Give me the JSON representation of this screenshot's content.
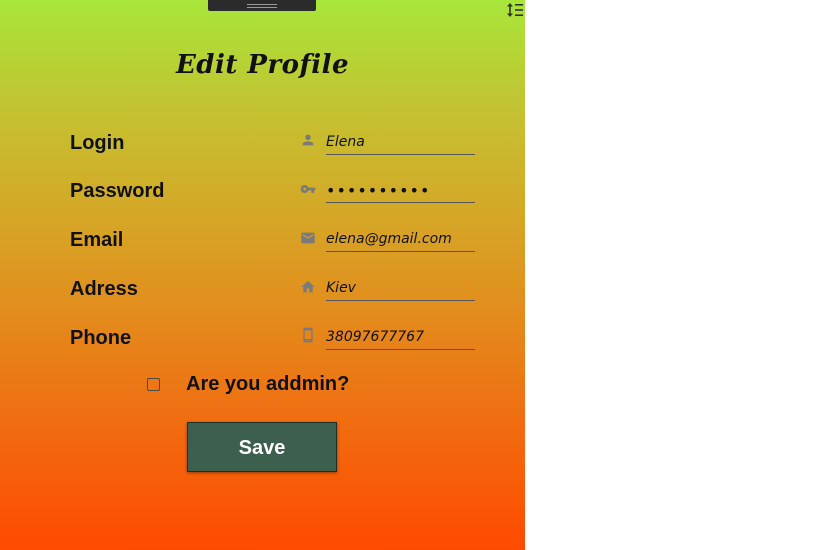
{
  "form": {
    "title": "Edit Profile",
    "fields": [
      {
        "label": "Login",
        "icon": "person-icon",
        "value": "Elena"
      },
      {
        "label": "Password",
        "icon": "key-icon",
        "value": "••••••••••"
      },
      {
        "label": "Email",
        "icon": "email-icon",
        "value": "elena@gmail.com"
      },
      {
        "label": "Adress",
        "icon": "home-icon",
        "value": "Kiev"
      },
      {
        "label": "Phone",
        "icon": "phone-icon",
        "value": "38097677767"
      }
    ],
    "admin_checkbox": {
      "label": "Are you addmin?",
      "checked": false
    },
    "save_label": "Save"
  },
  "toolbar": {
    "sort_icon": "line-spacing-icon"
  },
  "colors": {
    "gradient_top": "#a8e63a",
    "gradient_bottom": "#ff4a00",
    "save_button": "#3d5f4d"
  }
}
